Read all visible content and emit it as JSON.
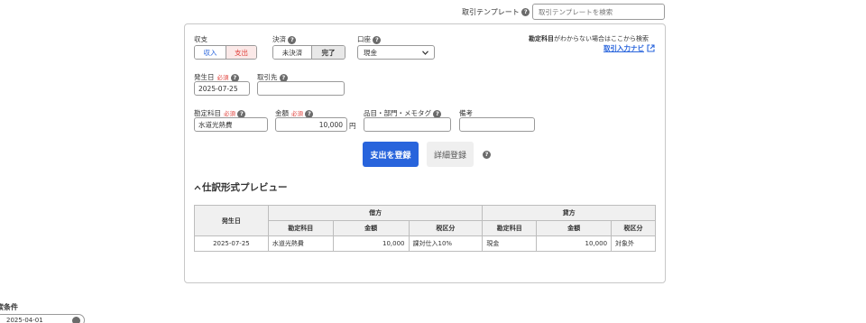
{
  "template": {
    "label": "取引テンプレート",
    "placeholder": "取引テンプレートを検索"
  },
  "form": {
    "income_expense": {
      "label": "収支",
      "options": [
        "収入",
        "支出"
      ],
      "selected": "支出"
    },
    "settlement": {
      "label": "決済",
      "options": [
        "未決済",
        "完了"
      ],
      "selected": "完了"
    },
    "account": {
      "label": "口座",
      "value": "現金"
    },
    "hint": {
      "prefix": "勘定科目",
      "text": "がわからない場合はここから検索",
      "link": "取引入力ナビ"
    },
    "date": {
      "label": "発生日",
      "required": "必須",
      "value": "2025-07-25"
    },
    "partner": {
      "label": "取引先",
      "value": ""
    },
    "account_item": {
      "label": "勘定科目",
      "required": "必須",
      "value": "水道光熱費"
    },
    "amount": {
      "label": "金額",
      "required": "必須",
      "value": "10,000",
      "unit": "円"
    },
    "tags": {
      "label": "品目・部門・メモタグ",
      "value": ""
    },
    "memo": {
      "label": "備考",
      "value": ""
    },
    "register_button": "支出を登録",
    "detail_button": "詳細登録"
  },
  "preview": {
    "title": "仕訳形式プレビュー",
    "headers": {
      "date": "発生日",
      "debit": "借方",
      "credit": "貸方",
      "account": "勘定科目",
      "amount": "金額",
      "tax": "税区分"
    },
    "row": {
      "date": "2025-07-25",
      "debit_account": "水道光熱費",
      "debit_amount": "10,000",
      "debit_tax": "課対仕入10%",
      "credit_account": "現金",
      "credit_amount": "10,000",
      "credit_tax": "対象外"
    }
  },
  "search": {
    "title": "索条件",
    "date_value": "2025-04-01"
  },
  "colors": {
    "primary": "#2864dc",
    "required": "#e0403a",
    "income": "#2864dc",
    "expense": "#e0403a"
  },
  "icons": {
    "help": "help-icon",
    "external": "external-link-icon",
    "chevron": "chevron-up-icon",
    "dropdown": "dropdown-caret-icon"
  }
}
